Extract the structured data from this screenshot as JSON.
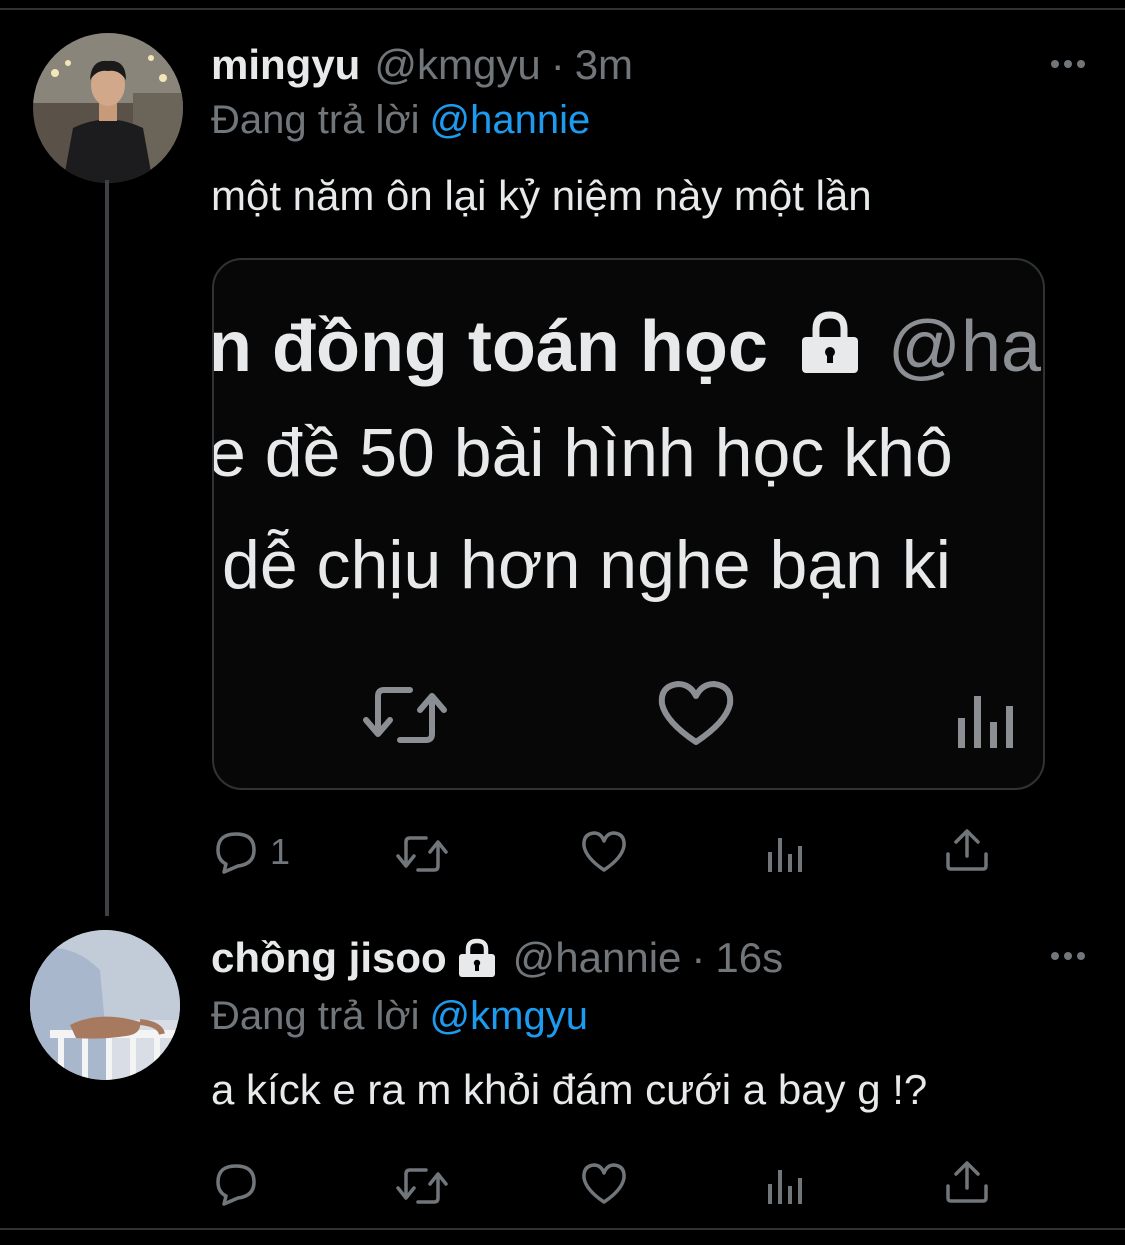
{
  "tweets": [
    {
      "name": "mingyu",
      "handle": "@kmgyu",
      "separator": "·",
      "time": "3m",
      "replying_label": "Đang trả lời",
      "replying_to": "@hannie",
      "text": "một năm ôn lại kỷ niệm này một lần",
      "reply_count": "1",
      "locked": false
    },
    {
      "name": "chồng jisoo",
      "handle": "@hannie",
      "separator": "·",
      "time": "16s",
      "replying_label": "Đang trả lời",
      "replying_to": "@kmgyu",
      "text": "a kíck e ra m khỏi đám cưới a bay g !?",
      "reply_count": "",
      "locked": true
    }
  ],
  "media_screenshot": {
    "line1_name": "n đồng toán học",
    "line1_handle": "@ha",
    "line2": "e đề 50 bài hình học khô",
    "line3": "dễ chịu hơn nghe bạn ki"
  },
  "icons": [
    "more-icon",
    "reply-icon",
    "retweet-icon",
    "like-icon",
    "views-icon",
    "share-icon",
    "lock-icon"
  ],
  "colors": {
    "background": "#000000",
    "text_primary": "#e7e9ea",
    "text_secondary": "#71767b",
    "mention": "#1d9bf0",
    "divider": "#2f3336"
  }
}
